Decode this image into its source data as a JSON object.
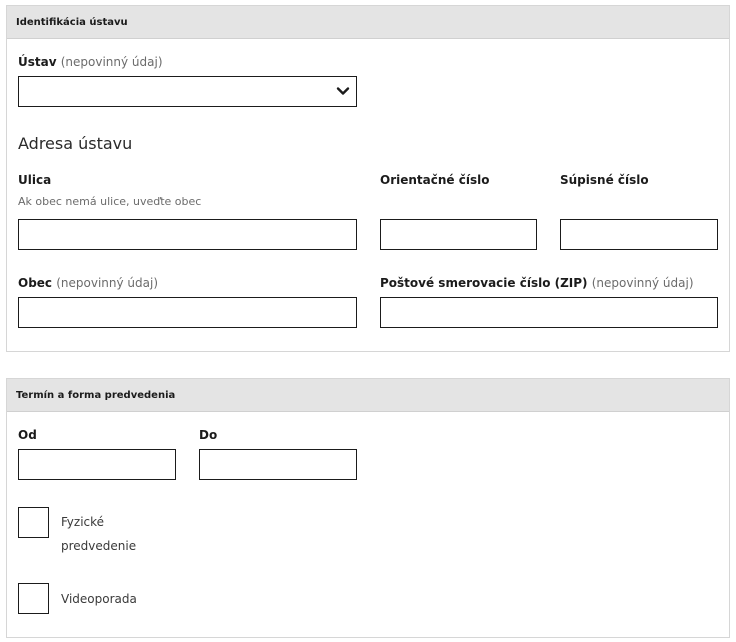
{
  "institution": {
    "header": "Identifikácia ústavu",
    "ustav": {
      "label": "Ústav",
      "optional": "(nepovinný údaj)",
      "selected_value": ""
    },
    "address_heading": "Adresa ústavu",
    "street": {
      "label": "Ulica",
      "hint": "Ak obec nemá ulice, uveďte obec",
      "value": ""
    },
    "orientation_number": {
      "label": "Orientačné číslo",
      "value": ""
    },
    "registry_number": {
      "label": "Súpisné číslo",
      "value": ""
    },
    "municipality": {
      "label": "Obec",
      "optional": "(nepovinný údaj)",
      "value": ""
    },
    "postal_code": {
      "label": "Poštové smerovacie číslo (ZIP)",
      "optional": "(nepovinný údaj)",
      "value": ""
    }
  },
  "schedule": {
    "header": "Termín a forma predvedenia",
    "from": {
      "label": "Od",
      "value": ""
    },
    "to": {
      "label": "Do",
      "value": ""
    },
    "physical": {
      "label_line1": "Fyzické",
      "label_line2": "predvedenie",
      "checked": false
    },
    "video": {
      "label": "Videoporada",
      "checked": false
    }
  }
}
